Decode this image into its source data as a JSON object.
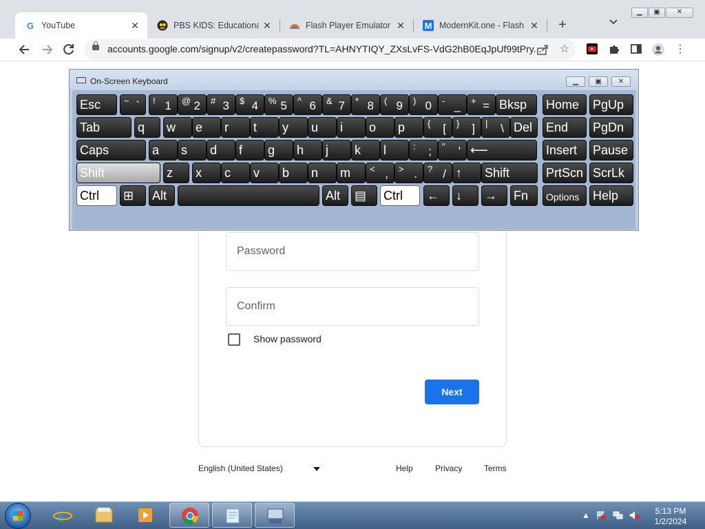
{
  "browser": {
    "tabs": [
      {
        "title": "YouTube",
        "favicon": "google-g-icon",
        "active": true
      },
      {
        "title": "PBS KIDS: Educational G",
        "favicon": "pbs-kids-icon",
        "active": false
      },
      {
        "title": "Flash Player Emulator 20",
        "favicon": "flash-emulator-icon",
        "active": false
      },
      {
        "title": "ModernKit.one - Flash Pl",
        "favicon": "modernkit-m-icon",
        "active": false
      }
    ],
    "close_glyph": "✕",
    "new_tab_glyph": "+",
    "url": "accounts.google.com/signup/v2/createpassword?TL=AHNYTIQY_ZXsLvFS-VdG2hB0EqJpUf99tPry..."
  },
  "signup": {
    "password_placeholder": "Password",
    "confirm_placeholder": "Confirm",
    "show_password_label": "Show password",
    "next_label": "Next"
  },
  "footer": {
    "language": "English (United States)",
    "help": "Help",
    "privacy": "Privacy",
    "terms": "Terms"
  },
  "osk": {
    "title": "On-Screen Keyboard",
    "rows": [
      [
        {
          "main": "Esc"
        },
        {
          "upper": "~",
          "lower": "`"
        },
        {
          "upper": "!",
          "lower": "1"
        },
        {
          "upper": "@",
          "lower": "2"
        },
        {
          "upper": "#",
          "lower": "3"
        },
        {
          "upper": "$",
          "lower": "4"
        },
        {
          "upper": "%",
          "lower": "5"
        },
        {
          "upper": "^",
          "lower": "6"
        },
        {
          "upper": "&",
          "lower": "7"
        },
        {
          "upper": "*",
          "lower": "8"
        },
        {
          "upper": "(",
          "lower": "9"
        },
        {
          "upper": ")",
          "lower": "0"
        },
        {
          "upper": "-",
          "lower": "_"
        },
        {
          "upper": "+",
          "lower": "="
        },
        {
          "main": "Bksp"
        },
        {
          "main": "Home"
        },
        {
          "main": "PgUp"
        }
      ],
      [
        {
          "main": "Tab"
        },
        {
          "main": "q"
        },
        {
          "main": "w"
        },
        {
          "main": "e"
        },
        {
          "main": "r"
        },
        {
          "main": "t"
        },
        {
          "main": "y"
        },
        {
          "main": "u"
        },
        {
          "main": "i"
        },
        {
          "main": "o"
        },
        {
          "main": "p"
        },
        {
          "upper": "{",
          "lower": "["
        },
        {
          "upper": "}",
          "lower": "]"
        },
        {
          "upper": "|",
          "lower": "\\"
        },
        {
          "main": "Del"
        },
        {
          "main": "End"
        },
        {
          "main": "PgDn"
        }
      ],
      [
        {
          "main": "Caps"
        },
        {
          "main": "a"
        },
        {
          "main": "s"
        },
        {
          "main": "d"
        },
        {
          "main": "f"
        },
        {
          "main": "g"
        },
        {
          "main": "h"
        },
        {
          "main": "j"
        },
        {
          "main": "k"
        },
        {
          "main": "l"
        },
        {
          "upper": ":",
          "lower": ";"
        },
        {
          "upper": "\"",
          "lower": "'"
        },
        {
          "main": "⟵"
        },
        {
          "main": "Insert"
        },
        {
          "main": "Pause"
        }
      ],
      [
        {
          "main": "Shift",
          "state": "selected"
        },
        {
          "main": "z"
        },
        {
          "main": "x"
        },
        {
          "main": "c"
        },
        {
          "main": "v"
        },
        {
          "main": "b"
        },
        {
          "main": "n"
        },
        {
          "main": "m"
        },
        {
          "upper": "<",
          "lower": ","
        },
        {
          "upper": ">",
          "lower": "."
        },
        {
          "upper": "?",
          "lower": "/"
        },
        {
          "main": "↑"
        },
        {
          "main": "Shift"
        },
        {
          "main": "PrtScn"
        },
        {
          "main": "ScrLk"
        }
      ],
      [
        {
          "main": "Ctrl",
          "state": "pressed"
        },
        {
          "main": "⊞"
        },
        {
          "main": "Alt"
        },
        {
          "main": ""
        },
        {
          "main": "Alt"
        },
        {
          "main": "▤"
        },
        {
          "main": "Ctrl",
          "state": "pressed"
        },
        {
          "main": "←"
        },
        {
          "main": "↓"
        },
        {
          "main": "→"
        },
        {
          "main": "Fn"
        },
        {
          "main": "Options",
          "small": true
        },
        {
          "main": "Help"
        }
      ]
    ]
  },
  "taskbar": {
    "apps": [
      "internet-explorer",
      "file-explorer",
      "media-player",
      "chrome",
      "notepad-app",
      "on-screen-keyboard-app"
    ],
    "time": "5:13 PM",
    "date": "1/2/2024"
  }
}
